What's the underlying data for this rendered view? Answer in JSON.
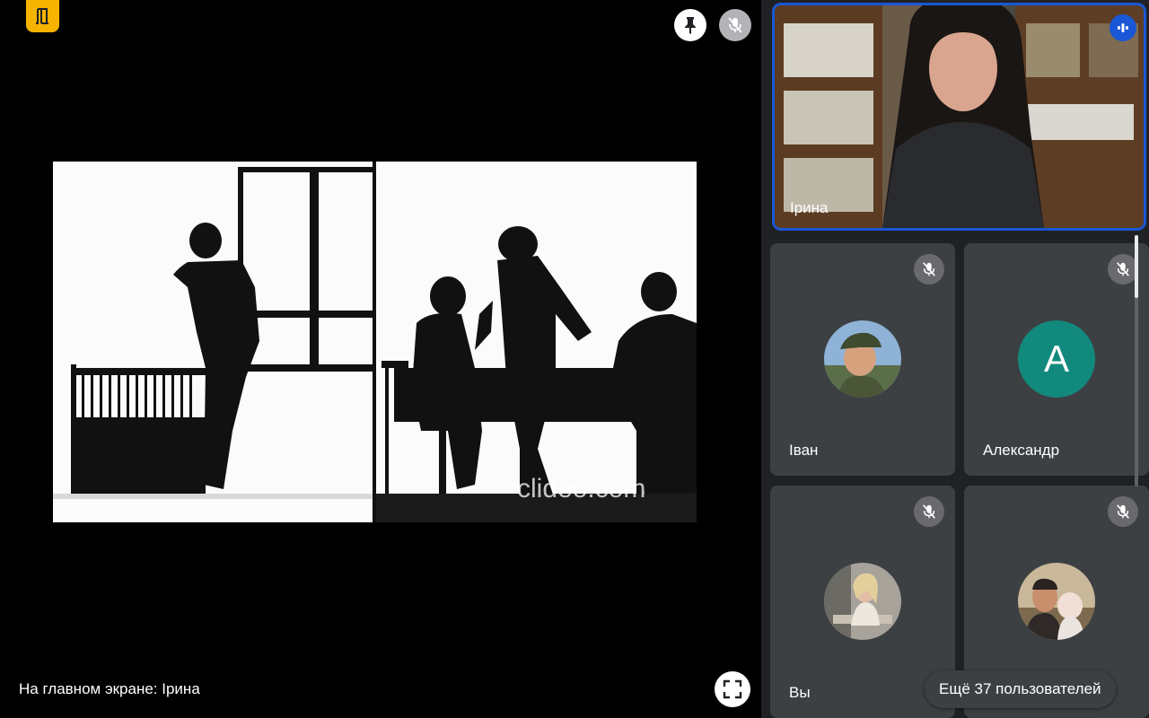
{
  "stage": {
    "spotlight_caption": "На главном экране: Ірина",
    "watermark": "clideo.com",
    "app_badge_icon": "door-icon",
    "pin_icon": "pin-icon",
    "mute_icon": "mic-off-icon",
    "fullscreen_icon": "fullscreen-icon"
  },
  "active_tile": {
    "name": "Ірина",
    "status_icon": "speaking-indicator-icon"
  },
  "participants": [
    {
      "name": "Іван",
      "avatar": "photo",
      "muted": true
    },
    {
      "name": "Александр",
      "avatar": "initial",
      "initial": "A",
      "muted": true
    },
    {
      "name": "Вы",
      "avatar": "photo",
      "muted": true
    },
    {
      "name": "",
      "avatar": "photo",
      "muted": true
    }
  ],
  "more_participants_label": "Ещё 37 пользователей",
  "colors": {
    "accent_blue": "#1a57d6",
    "badge_yellow": "#f6b400",
    "avatar_teal": "#12897d",
    "tile_bg": "#3c4043",
    "panel_bg": "#202124"
  }
}
